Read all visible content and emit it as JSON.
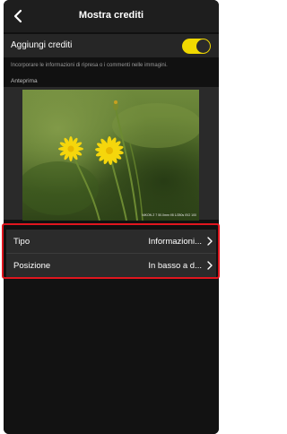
{
  "header": {
    "title": "Mostra crediti",
    "back_icon": "chevron-left-icon"
  },
  "credits_toggle": {
    "label": "Aggiungi crediti",
    "enabled": true,
    "color": "#f0d800"
  },
  "description": "Incorporare le informazioni di ripresa o i commenti nelle immagini.",
  "preview": {
    "label": "Anteprima",
    "watermark": "NIKON Z 7  50.0mm  f/8  1/250s  ISO 100"
  },
  "settings": [
    {
      "label": "Tipo",
      "value": "Informazioni...",
      "icon": "chevron-right-icon"
    },
    {
      "label": "Posizione",
      "value": "In basso a d...",
      "icon": "chevron-right-icon"
    }
  ],
  "highlight_color": "#e0161e"
}
